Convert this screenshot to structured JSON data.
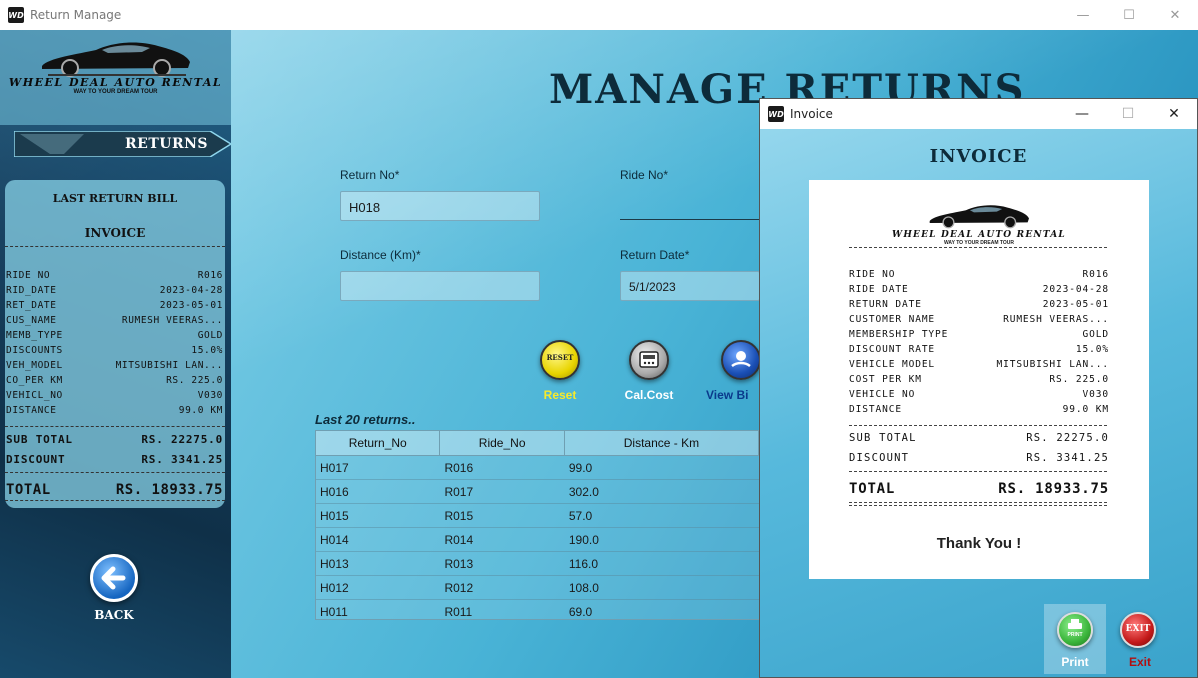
{
  "window": {
    "app_icon": "WD",
    "title": "Return Manage",
    "controls": [
      "—",
      "☐",
      "✕"
    ]
  },
  "brand": {
    "name": "WHEEL DEAL AUTO RENTAL",
    "tagline": "WAY TO YOUR DREAM TOUR"
  },
  "sidebar": {
    "returns_label": "RETURNS",
    "last_bill": {
      "heading": "LAST RETURN BILL",
      "invoice_heading": "INVOICE",
      "rows": [
        {
          "k": "Ride no",
          "v": "R016"
        },
        {
          "k": "Rid_Date",
          "v": "2023-04-28"
        },
        {
          "k": "Ret_Date",
          "v": "2023-05-01"
        },
        {
          "k": "Cus_Name",
          "v": "Rumesh Veeras..."
        },
        {
          "k": "Memb_Type",
          "v": "Gold"
        },
        {
          "k": "Discounts",
          "v": "15.0%"
        },
        {
          "k": "Veh_Model",
          "v": "Mitsubishi Lan..."
        },
        {
          "k": "Co_per Km",
          "v": "Rs. 225.0"
        },
        {
          "k": "Vehicl_No",
          "v": "V030"
        },
        {
          "k": "Distance",
          "v": "99.0 Km"
        }
      ],
      "sub_total_label": "Sub Total",
      "sub_total": "Rs. 22275.0",
      "discount_label": "Discount",
      "discount": "Rs. 3341.25",
      "total_label": "Total",
      "total": "Rs. 18933.75"
    },
    "back_label": "BACK"
  },
  "main": {
    "title": "MANAGE RETURNS",
    "fields": {
      "return_no_label": "Return No*",
      "return_no_value": "H018",
      "ride_no_label": "Ride No*",
      "distance_label": "Distance (Km)*",
      "distance_value": "",
      "return_date_label": "Return Date*",
      "return_date_value": "5/1/2023"
    },
    "buttons": {
      "reset_icon_text": "RESET",
      "reset": "Reset",
      "calc": "Cal.Cost",
      "view_bill": "View Bi"
    },
    "table": {
      "caption": "Last 20 returns..",
      "columns": [
        "Return_No",
        "Ride_No",
        "Distance - Km"
      ],
      "rows": [
        [
          "H017",
          "R016",
          "99.0"
        ],
        [
          "H016",
          "R017",
          "302.0"
        ],
        [
          "H015",
          "R015",
          "57.0"
        ],
        [
          "H014",
          "R014",
          "190.0"
        ],
        [
          "H013",
          "R013",
          "116.0"
        ],
        [
          "H012",
          "R012",
          "108.0"
        ],
        [
          "H011",
          "R011",
          "69.0"
        ]
      ]
    }
  },
  "invoice_window": {
    "app_icon": "WD",
    "title": "Invoice",
    "controls": [
      "—",
      "☐",
      "✕"
    ],
    "heading": "INVOICE",
    "rows": [
      {
        "k": "Ride no",
        "v": "R016"
      },
      {
        "k": "Ride Date",
        "v": "2023-04-28"
      },
      {
        "k": "Return Date",
        "v": "2023-05-01"
      },
      {
        "k": "Customer Name",
        "v": "Rumesh Veeras..."
      },
      {
        "k": "Membership Type",
        "v": "Gold"
      },
      {
        "k": "Discount  Rate",
        "v": "15.0%"
      },
      {
        "k": "Vehicle Model",
        "v": "Mitsubishi Lan..."
      },
      {
        "k": "Cost per Km",
        "v": "Rs. 225.0"
      },
      {
        "k": "Vehicle No",
        "v": "V030"
      },
      {
        "k": "Distance",
        "v": "99.0 Km"
      }
    ],
    "sub_total_label": "Sub Total",
    "sub_total": "Rs. 22275.0",
    "discount_label": "Discount",
    "discount": "Rs. 3341.25",
    "total_label": "Total",
    "total": "Rs. 18933.75",
    "thanks": "Thank You !",
    "print_icon_text": "PRINT",
    "print_label": "Print",
    "exit_icon_text": "EXIT",
    "exit_label": "Exit"
  },
  "colors": {
    "accent_reset": "#f2e600",
    "accent_print": "#3bb53b",
    "accent_exit": "#c41a1a",
    "view_bill": "#0a3a8c"
  }
}
